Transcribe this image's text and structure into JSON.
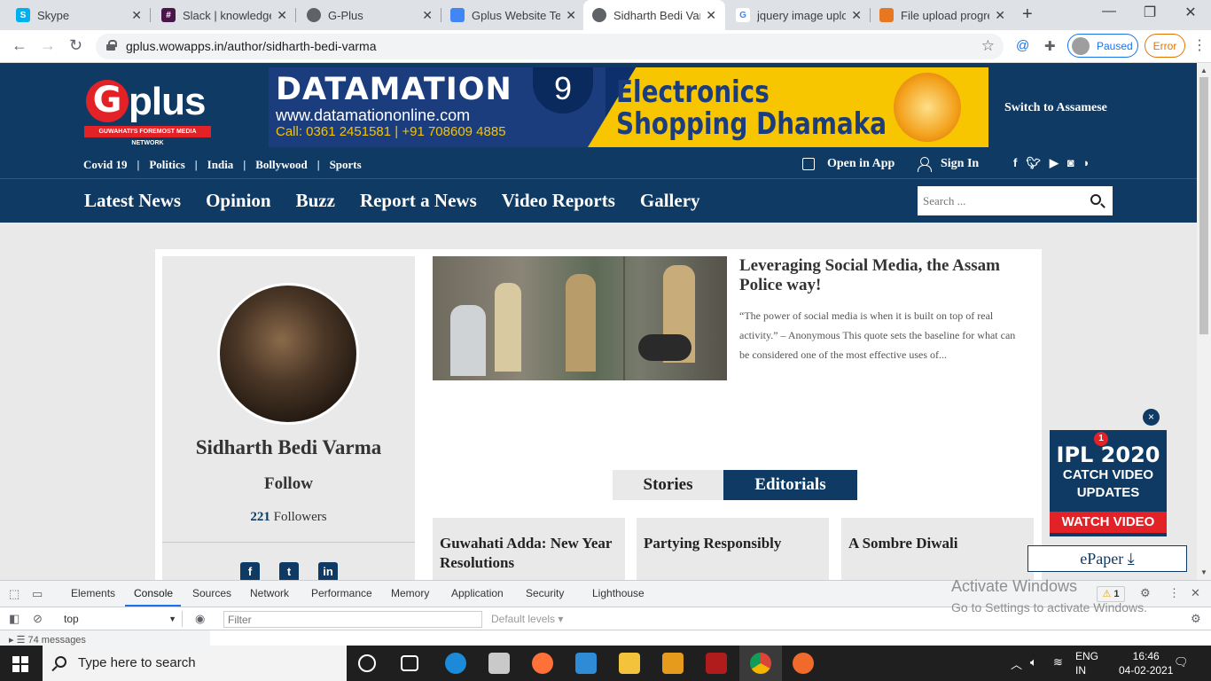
{
  "browser": {
    "tabs": [
      {
        "title": "Skype",
        "fav_color": "#00aff0",
        "fav_letter": "S"
      },
      {
        "title": "Slack | knowledge",
        "fav_color": "#4a154b",
        "fav_letter": "#"
      },
      {
        "title": "G-Plus",
        "fav_color": "#5f6368",
        "fav_letter": ""
      },
      {
        "title": "Gplus Website Tes",
        "fav_color": "#4285f4",
        "fav_letter": ""
      },
      {
        "title": "Sidharth Bedi Varm",
        "fav_color": "#5f6368",
        "fav_letter": ""
      },
      {
        "title": "jquery image uplo",
        "fav_color": "#ffffff",
        "fav_letter": "G"
      },
      {
        "title": "File upload progre",
        "fav_color": "#e87722",
        "fav_letter": ""
      }
    ],
    "active_tab_index": 4,
    "url": "gplus.wowapps.in/author/sidharth-bedi-varma",
    "profile_label": "Paused",
    "error_label": "Error"
  },
  "site": {
    "brand_primary": "#0f3a63",
    "brand_accent": "#e32227",
    "logo_letter": "G",
    "logo_text": "plus",
    "logo_tagline": "GUWAHATI'S FOREMOST MEDIA NETWORK",
    "banner": {
      "title": "DATAMATION",
      "website": "www.datamationonline.com",
      "phone": "Call: 0361 2451581 | +91 708609 4885",
      "number": "9",
      "promo_line1": "Electronics",
      "promo_line2": "Shopping Dhamaka"
    },
    "switch_language": "Switch to Assamese",
    "top_nav": [
      "Covid 19",
      "Politics",
      "India",
      "Bollywood",
      "Sports"
    ],
    "open_in_app": "Open in App",
    "sign_in": "Sign In",
    "social_icons": [
      "f",
      "t",
      "yt",
      "ig",
      "rss"
    ],
    "main_nav": [
      "Latest News",
      "Opinion",
      "Buzz",
      "Report a News",
      "Video Reports",
      "Gallery"
    ],
    "search_placeholder": "Search ..."
  },
  "author": {
    "name": "Sidharth Bedi Varma",
    "follow_label": "Follow",
    "followers_count": "221",
    "followers_label": "Followers",
    "social": [
      "f",
      "t",
      "in"
    ]
  },
  "featured": {
    "title": "Leveraging Social Media, the Assam Police way!",
    "excerpt": "“The power of social media is when it is built on top of real activity.” – Anonymous This quote sets the baseline for what can be considered one of the most effective uses of..."
  },
  "content_tabs": {
    "stories": "Stories",
    "editorials": "Editorials"
  },
  "stories": [
    {
      "title": "Guwahati Adda: New Year Resolutions"
    },
    {
      "title": "Partying Responsibly"
    },
    {
      "title": "A Sombre Diwali"
    }
  ],
  "ipl_ad": {
    "badge": "1",
    "line1": "IPL 2020",
    "line2": "CATCH VIDEO",
    "line3": "UPDATES",
    "cta": "WATCH VIDEO",
    "close": "×"
  },
  "epaper_label": "ePaper",
  "devtools": {
    "tabs": [
      "Elements",
      "Console",
      "Sources",
      "Network",
      "Performance",
      "Memory",
      "Application",
      "Security",
      "Lighthouse"
    ],
    "active_tab": "Console",
    "warning_count": "1",
    "context": "top",
    "filter_placeholder": "Filter",
    "levels": "Default levels",
    "messages": "74 messages"
  },
  "activation": {
    "line1": "Activate Windows",
    "line2": "Go to Settings to activate Windows."
  },
  "taskbar": {
    "search_placeholder": "Type here to search",
    "lang_line1": "ENG",
    "lang_line2": "IN",
    "time": "16:46",
    "date": "04-02-2021"
  }
}
